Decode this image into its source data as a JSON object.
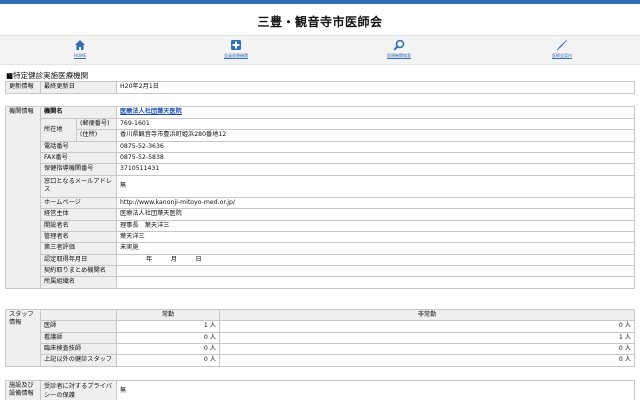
{
  "header": {
    "title": "三豊・観音寺市医師会"
  },
  "navbar": {
    "items": [
      {
        "label": "HOME"
      },
      {
        "label": "会員医療機関"
      },
      {
        "label": "医療機関検索"
      },
      {
        "label": "医師会案内"
      }
    ]
  },
  "section": {
    "title": "■特定健診実施医療機関"
  },
  "update": {
    "group": "更新情報",
    "label": "最終更新日",
    "value": "H20年2月1日"
  },
  "facility": {
    "group": "機関情報",
    "name_label": "機関名",
    "name_value": "医療法人社団葉天医院",
    "address_label": "所在地",
    "postal_label": "(郵便番号)",
    "postal_value": "769-1601",
    "addr_label": "(住所)",
    "addr_value": "香川県観音寺市豊浜町姫浜280番地12",
    "phone_label": "電話番号",
    "phone_value": "0875-52-3636",
    "fax_label": "FAX番号",
    "fax_value": "0875-52-5838",
    "insurer_label": "保健指導機関番号",
    "insurer_value": "3710511431",
    "email_label": "窓口となるメールアドレス",
    "email_value": "無",
    "homepage_label": "ホームページ",
    "homepage_value": "http://www.kanonji-mitoyo-med.or.jp/",
    "operator_label": "経営主体",
    "operator_value": "医療法人社団葉天医院",
    "founder_label": "開設者名",
    "founder_value": "理事長　葉天洋三",
    "manager_label": "管理者名",
    "manager_value": "葉天洋三",
    "thirdparty_label": "第三者評価",
    "thirdparty_value": "未実施",
    "certdate_label": "認定取得年月日",
    "certdate_value": "年　　　月　　　日",
    "contract_label": "契約取りまとめ機関名",
    "contract_value": "",
    "org_label": "所属組織名",
    "org_value": ""
  },
  "staff": {
    "group": "スタッフ情報",
    "col_full": "常勤",
    "col_part": "非常勤",
    "rows": [
      {
        "role": "医師",
        "full": "1 人",
        "part": "0 人"
      },
      {
        "role": "看護師",
        "full": "0 人",
        "part": "1 人"
      },
      {
        "role": "臨床検査技師",
        "full": "0 人",
        "part": "0 人"
      },
      {
        "role": "上記以外の健診スタッフ",
        "full": "0 人",
        "part": "0 人"
      }
    ]
  },
  "equipment": {
    "group": "施設及び設備情報",
    "privacy_label": "受診者に対するプライバシーの保護",
    "privacy_value": "無"
  },
  "colors": {
    "accent": "#2f6fb6",
    "link": "#1a4fb0",
    "label_bg": "#efefef"
  }
}
